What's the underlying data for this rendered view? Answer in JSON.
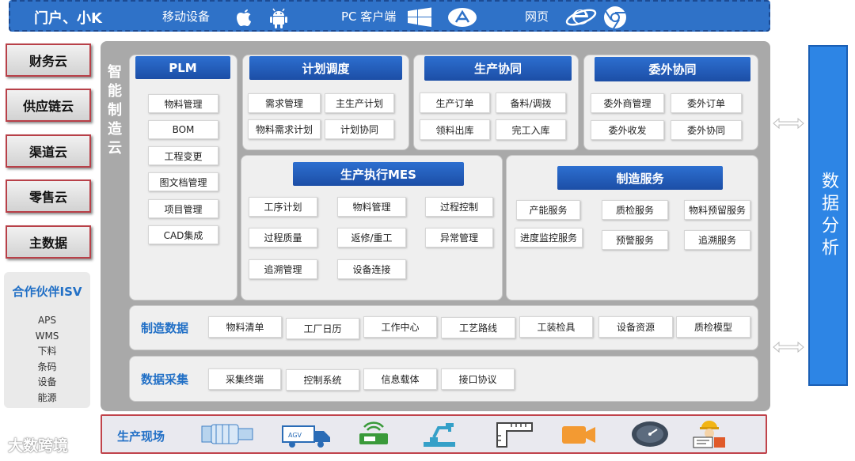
{
  "top": {
    "brand": "门户、小K",
    "mobile": "移动设备",
    "pc": "PC 客户端",
    "web": "网页",
    "icons": [
      "apple-icon",
      "android-icon",
      "windows-icon",
      "app-store-icon",
      "ie-icon",
      "chrome-icon"
    ]
  },
  "left": {
    "clouds": [
      "财务云",
      "供应链云",
      "渠道云",
      "零售云",
      "主数据"
    ],
    "isv_title": "合作伙伴ISV",
    "isv_items": [
      "APS",
      "WMS",
      "下料",
      "条码",
      "设备",
      "能源"
    ]
  },
  "main": {
    "side_label": "智能制造云",
    "plm": {
      "title": "PLM",
      "items": [
        "物料管理",
        "BOM",
        "工程变更",
        "图文档管理",
        "项目管理",
        "CAD集成"
      ]
    },
    "plan": {
      "title": "计划调度",
      "items": [
        "需求管理",
        "主生产计划",
        "物料需求计划",
        "计划协同"
      ]
    },
    "coop": {
      "title": "生产协同",
      "items": [
        "生产订单",
        "备料/调拨",
        "领料出库",
        "完工入库"
      ]
    },
    "outsource": {
      "title": "委外协同",
      "items": [
        "委外商管理",
        "委外订单",
        "委外收发",
        "委外协同"
      ]
    },
    "mes": {
      "title": "生产执行MES",
      "items": [
        "工序计划",
        "物料管理",
        "过程控制",
        "过程质量",
        "返修/重工",
        "异常管理",
        "追溯管理",
        "设备连接"
      ]
    },
    "service": {
      "title": "制造服务",
      "items": [
        "产能服务",
        "质检服务",
        "物料预留服务",
        "进度监控服务",
        "预警服务",
        "追溯服务"
      ]
    },
    "mfg_data": {
      "title": "制造数据",
      "items": [
        "物料清单",
        "工厂日历",
        "工作中心",
        "工艺路线",
        "工装检具",
        "设备资源",
        "质检模型"
      ]
    },
    "collect": {
      "title": "数据采集",
      "items": [
        "采集终端",
        "控制系统",
        "信息载体",
        "接口协议"
      ]
    }
  },
  "analysis": {
    "label": "数据分析"
  },
  "field": {
    "label": "生产现场",
    "icons": [
      "motor-icon",
      "agv-icon",
      "rfid-reader-icon",
      "robot-arm-icon",
      "measuring-tool-icon",
      "camera-icon",
      "gauge-icon",
      "worker-icon"
    ],
    "agv_text": "AGV"
  },
  "watermark": "大数跨境",
  "colors": {
    "accent": "#2270c6",
    "header": "#1c4ea6",
    "panel": "#a9a9a9",
    "border_red": "#b84048",
    "analysis": "#2d85e5"
  }
}
